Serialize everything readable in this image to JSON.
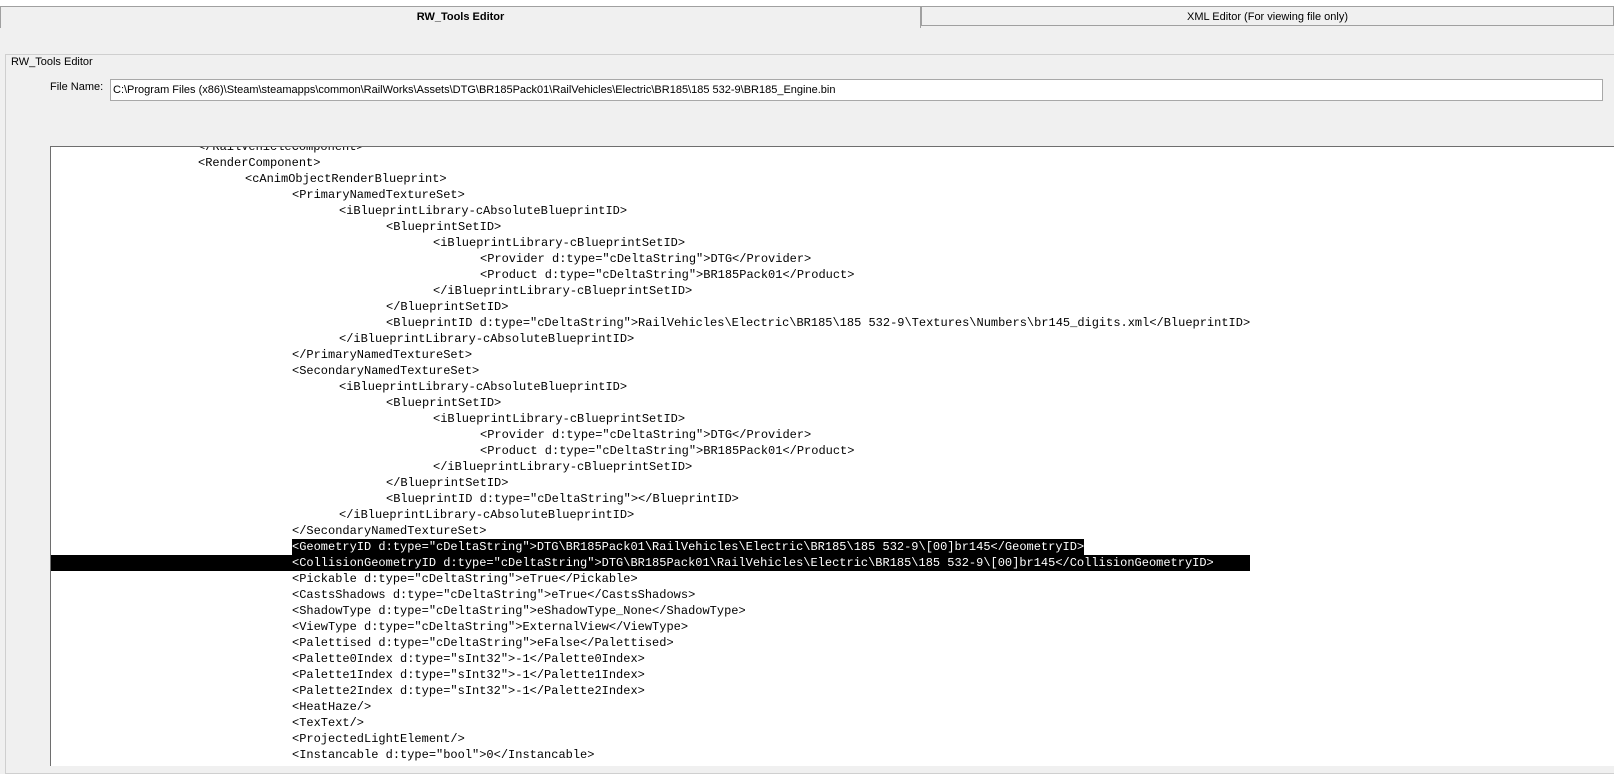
{
  "tabs": [
    {
      "label": "RW_Tools Editor",
      "active": true
    },
    {
      "label": "XML Editor (For viewing file only)",
      "active": false
    }
  ],
  "group": {
    "label": "RW_Tools Editor"
  },
  "file_name": {
    "label": "File Name:",
    "value": "C:\\Program Files (x86)\\Steam\\steamapps\\common\\RailWorks\\Assets\\DTG\\BR185Pack01\\RailVehicles\\Electric\\BR185\\185 532-9\\BR185_Engine.bin"
  },
  "xml_lines": [
    {
      "indent": 3,
      "text": "</RailVehicleComponent>"
    },
    {
      "indent": 3,
      "text": "<RenderComponent>"
    },
    {
      "indent": 4,
      "text": "<cAnimObjectRenderBlueprint>"
    },
    {
      "indent": 5,
      "text": "<PrimaryNamedTextureSet>"
    },
    {
      "indent": 6,
      "text": "<iBlueprintLibrary-cAbsoluteBlueprintID>"
    },
    {
      "indent": 7,
      "text": "<BlueprintSetID>"
    },
    {
      "indent": 8,
      "text": "<iBlueprintLibrary-cBlueprintSetID>"
    },
    {
      "indent": 9,
      "text": "<Provider d:type=\"cDeltaString\">DTG</Provider>"
    },
    {
      "indent": 9,
      "text": "<Product d:type=\"cDeltaString\">BR185Pack01</Product>"
    },
    {
      "indent": 8,
      "text": "</iBlueprintLibrary-cBlueprintSetID>"
    },
    {
      "indent": 7,
      "text": "</BlueprintSetID>"
    },
    {
      "indent": 7,
      "text": "<BlueprintID d:type=\"cDeltaString\">RailVehicles\\Electric\\BR185\\185 532-9\\Textures\\Numbers\\br145_digits.xml</BlueprintID>"
    },
    {
      "indent": 6,
      "text": "</iBlueprintLibrary-cAbsoluteBlueprintID>"
    },
    {
      "indent": 5,
      "text": "</PrimaryNamedTextureSet>"
    },
    {
      "indent": 5,
      "text": "<SecondaryNamedTextureSet>"
    },
    {
      "indent": 6,
      "text": "<iBlueprintLibrary-cAbsoluteBlueprintID>"
    },
    {
      "indent": 7,
      "text": "<BlueprintSetID>"
    },
    {
      "indent": 8,
      "text": "<iBlueprintLibrary-cBlueprintSetID>"
    },
    {
      "indent": 9,
      "text": "<Provider d:type=\"cDeltaString\">DTG</Provider>"
    },
    {
      "indent": 9,
      "text": "<Product d:type=\"cDeltaString\">BR185Pack01</Product>"
    },
    {
      "indent": 8,
      "text": "</iBlueprintLibrary-cBlueprintSetID>"
    },
    {
      "indent": 7,
      "text": "</BlueprintSetID>"
    },
    {
      "indent": 7,
      "text": "<BlueprintID d:type=\"cDeltaString\"></BlueprintID>"
    },
    {
      "indent": 6,
      "text": "</iBlueprintLibrary-cAbsoluteBlueprintID>"
    },
    {
      "indent": 5,
      "text": "</SecondaryNamedTextureSet>"
    },
    {
      "indent": 5,
      "text": "<GeometryID d:type=\"cDeltaString\">DTG\\BR185Pack01\\RailVehicles\\Electric\\BR185\\185 532-9\\[00]br145</GeometryID>",
      "selected": "partial"
    },
    {
      "indent": 5,
      "text": "<CollisionGeometryID d:type=\"cDeltaString\">DTG\\BR185Pack01\\RailVehicles\\Electric\\BR185\\185 532-9\\[00]br145</CollisionGeometryID>",
      "selected": "full"
    },
    {
      "indent": 5,
      "text": "<Pickable d:type=\"cDeltaString\">eTrue</Pickable>"
    },
    {
      "indent": 5,
      "text": "<CastsShadows d:type=\"cDeltaString\">eTrue</CastsShadows>"
    },
    {
      "indent": 5,
      "text": "<ShadowType d:type=\"cDeltaString\">eShadowType_None</ShadowType>"
    },
    {
      "indent": 5,
      "text": "<ViewType d:type=\"cDeltaString\">ExternalView</ViewType>"
    },
    {
      "indent": 5,
      "text": "<Palettised d:type=\"cDeltaString\">eFalse</Palettised>"
    },
    {
      "indent": 5,
      "text": "<Palette0Index d:type=\"sInt32\">-1</Palette0Index>"
    },
    {
      "indent": 5,
      "text": "<Palette1Index d:type=\"sInt32\">-1</Palette1Index>"
    },
    {
      "indent": 5,
      "text": "<Palette2Index d:type=\"sInt32\">-1</Palette2Index>"
    },
    {
      "indent": 5,
      "text": "<HeatHaze/>"
    },
    {
      "indent": 5,
      "text": "<TexText/>"
    },
    {
      "indent": 5,
      "text": "<ProjectedLightElement/>"
    },
    {
      "indent": 5,
      "text": "<Instancable d:type=\"bool\">0</Instancable>"
    }
  ]
}
